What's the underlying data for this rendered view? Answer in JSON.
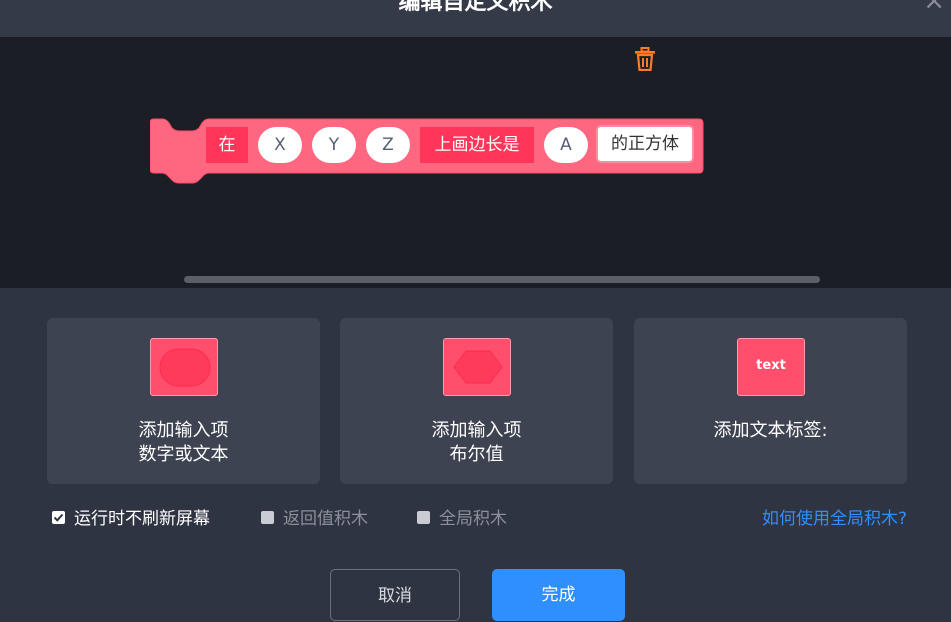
{
  "dialog": {
    "title": "编辑自定义积木",
    "close_icon": "×"
  },
  "block": {
    "segments": [
      {
        "kind": "label",
        "text": "在"
      },
      {
        "kind": "input",
        "text": "X"
      },
      {
        "kind": "input",
        "text": "Y"
      },
      {
        "kind": "input",
        "text": "Z"
      },
      {
        "kind": "label",
        "text": "上画边长是"
      },
      {
        "kind": "input",
        "text": "A"
      },
      {
        "kind": "text-input",
        "text": "的正方体"
      }
    ],
    "color": "#ff6680"
  },
  "cards": [
    {
      "thumb": "oval",
      "line1": "添加输入项",
      "line2": "数字或文本"
    },
    {
      "thumb": "hexagon",
      "line1": "添加输入项",
      "line2": "布尔值"
    },
    {
      "thumb": "text",
      "thumb_text": "text",
      "line1": "添加文本标签:",
      "line2": ""
    }
  ],
  "options": [
    {
      "label": "运行时不刷新屏幕",
      "checked": true
    },
    {
      "label": "返回值积木",
      "checked": false
    },
    {
      "label": "全局积木",
      "checked": false
    }
  ],
  "help_link": "如何使用全局积木?",
  "buttons": {
    "cancel": "取消",
    "ok": "完成"
  },
  "colors": {
    "accent": "#2f8fff",
    "block": "#ff6680",
    "block_label": "#ff3559"
  }
}
